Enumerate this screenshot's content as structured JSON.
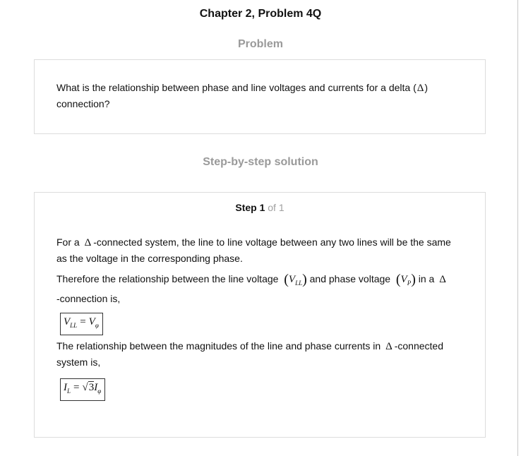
{
  "chapter_title": "Chapter 2, Problem 4Q",
  "problem": {
    "heading": "Problem",
    "question_part1": "What is the relationship between phase and line voltages and currents for a delta (",
    "delta_symbol": "Δ",
    "question_part2": ")",
    "question_line2": "connection?"
  },
  "solution": {
    "heading": "Step-by-step solution",
    "step_strong": "Step 1",
    "step_of": "of 1",
    "para1_pre": "For a",
    "para1_post": "-connected system, the line to line voltage between any two lines will be the same",
    "para1_line2": "as the voltage in the corresponding phase.",
    "para2_pre": "Therefore the relationship between the line voltage",
    "para2_mid": "and phase voltage",
    "para2_end": "in a",
    "para2_line2": "-connection is,",
    "v_ll_var": "V",
    "v_ll_sub": "LL",
    "v_p_var": "V",
    "v_p_sub": "P",
    "formula1_lhs_var": "V",
    "formula1_lhs_sub": "LL",
    "formula1_eq": "=",
    "formula1_rhs_var": "V",
    "formula1_rhs_sub": "φ",
    "para3_pre": "The relationship between the magnitudes of the line and phase currents in",
    "para3_post": "-connected",
    "para3_line2": "system is,",
    "formula2_lhs_var": "I",
    "formula2_lhs_sub": "L",
    "formula2_eq": "=",
    "formula2_sqrt": "√",
    "formula2_coeff": "3",
    "formula2_rhs_var": "I",
    "formula2_rhs_sub": "φ"
  }
}
